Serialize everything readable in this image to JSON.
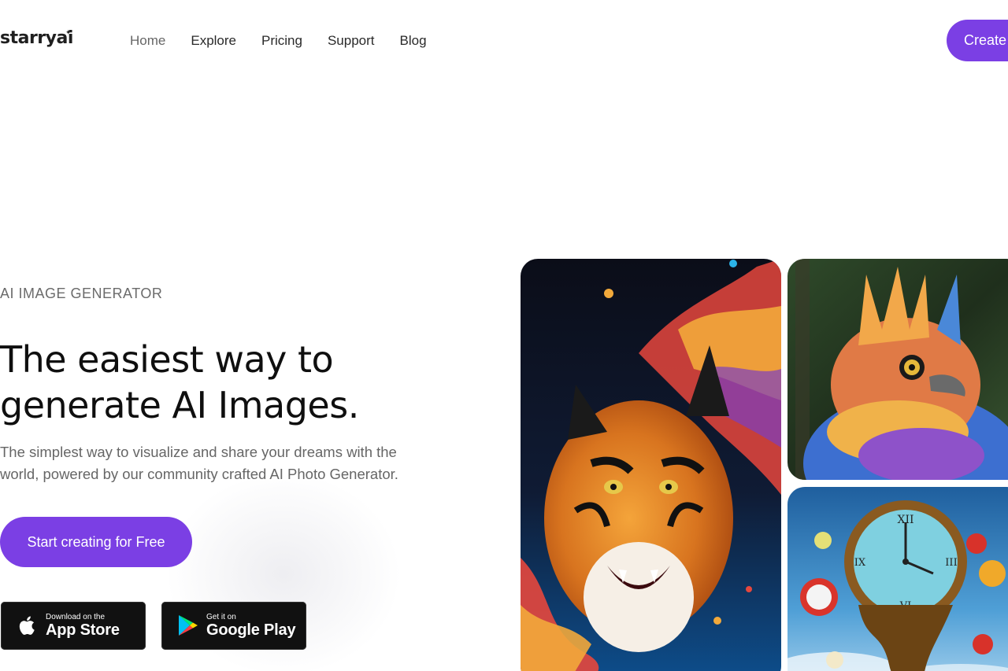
{
  "header": {
    "logo": "starryai",
    "nav": [
      "Home",
      "Explore",
      "Pricing",
      "Support",
      "Blog"
    ],
    "active_nav": "Home",
    "create_label": "Create"
  },
  "hero": {
    "eyebrow": "AI IMAGE GENERATOR",
    "headline_line1": "The easiest way to",
    "headline_line2": "generate AI Images.",
    "subtext_line1": "The simplest way to visualize and share your dreams with the",
    "subtext_line2": "world, powered by our community crafted AI Photo Generator.",
    "cta_label": "Start creating for Free"
  },
  "stores": {
    "apple": {
      "small": "Download on the",
      "big": "App Store",
      "icon": "apple-icon"
    },
    "google": {
      "small": "Get it on",
      "big": "Google Play",
      "icon": "google-play-icon"
    }
  },
  "gallery": {
    "images": [
      "tiger-image",
      "bird-image",
      "melting-clock-image"
    ]
  },
  "colors": {
    "accent": "#7b3fe4",
    "text": "#0f0f0f",
    "muted": "#666666",
    "store_bg": "#111111"
  }
}
